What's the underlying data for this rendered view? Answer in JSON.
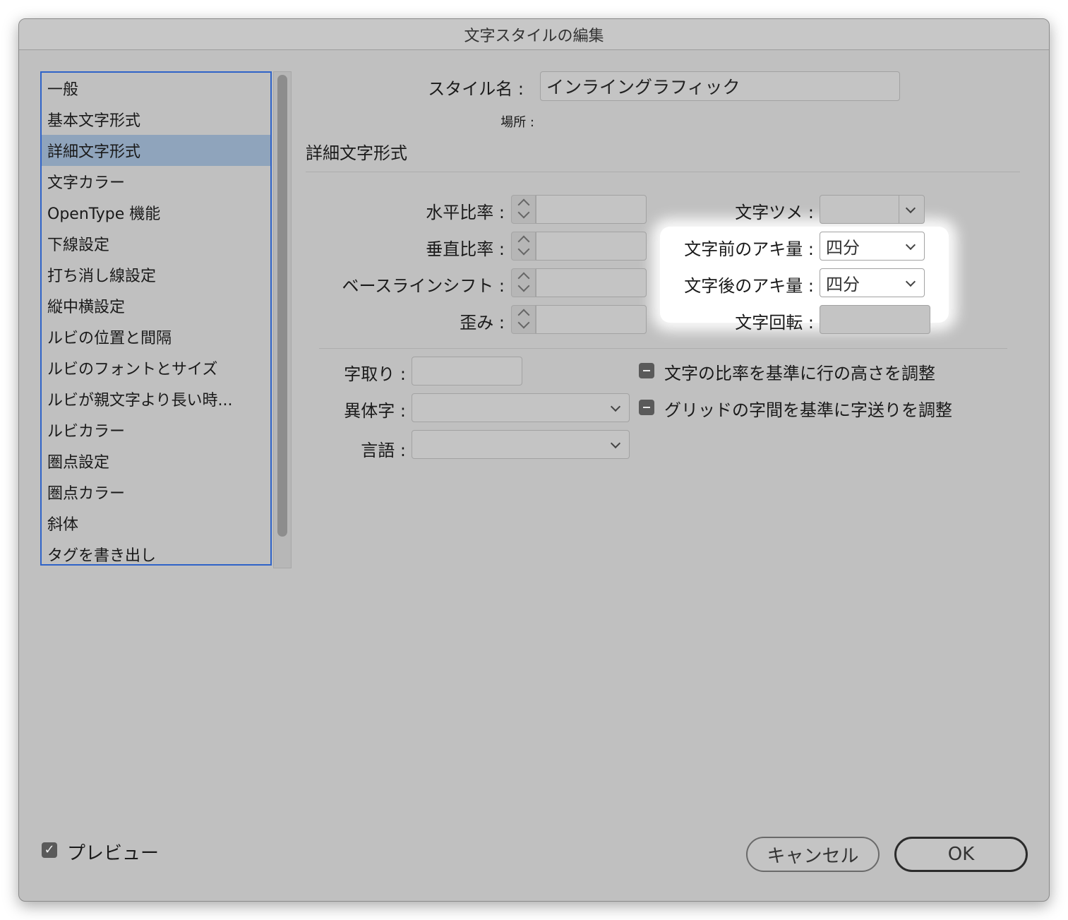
{
  "window": {
    "title": "文字スタイルの編集"
  },
  "sidebar": {
    "items": [
      {
        "label": "一般"
      },
      {
        "label": "基本文字形式"
      },
      {
        "label": "詳細文字形式",
        "selected": true
      },
      {
        "label": "文字カラー"
      },
      {
        "label": "OpenType 機能"
      },
      {
        "label": "下線設定"
      },
      {
        "label": "打ち消し線設定"
      },
      {
        "label": "縦中横設定"
      },
      {
        "label": "ルビの位置と間隔"
      },
      {
        "label": "ルビのフォントとサイズ"
      },
      {
        "label": "ルビが親文字より長い時..."
      },
      {
        "label": "ルビカラー"
      },
      {
        "label": "圏点設定"
      },
      {
        "label": "圏点カラー"
      },
      {
        "label": "斜体"
      },
      {
        "label": "タグを書き出し"
      }
    ]
  },
  "header": {
    "style_name_label": "スタイル名 :",
    "style_name_value": "インライングラフィック",
    "location_label": "場所 :"
  },
  "section": {
    "title": "詳細文字形式"
  },
  "fields": {
    "horizontal_scale_label": "水平比率 :",
    "vertical_scale_label": "垂直比率 :",
    "baseline_shift_label": "ベースラインシフト :",
    "skew_label": "歪み :",
    "tsume_label": "文字ツメ :",
    "aki_before_label": "文字前のアキ量 :",
    "aki_before_value": "四分",
    "aki_after_label": "文字後のアキ量 :",
    "aki_after_value": "四分",
    "char_rotation_label": "文字回転 :",
    "jidori_label": "字取り :",
    "alternate_glyph_label": "異体字 :",
    "language_label": "言語 :",
    "scale_line_height_label": "文字の比率を基準に行の高さを調整",
    "grid_spacing_label": "グリッドの字間を基準に字送りを調整"
  },
  "footer": {
    "preview_label": "プレビュー",
    "preview_checked": true,
    "cancel_label": "キャンセル",
    "ok_label": "OK"
  },
  "icons": {
    "checkbox_check": "✓"
  }
}
